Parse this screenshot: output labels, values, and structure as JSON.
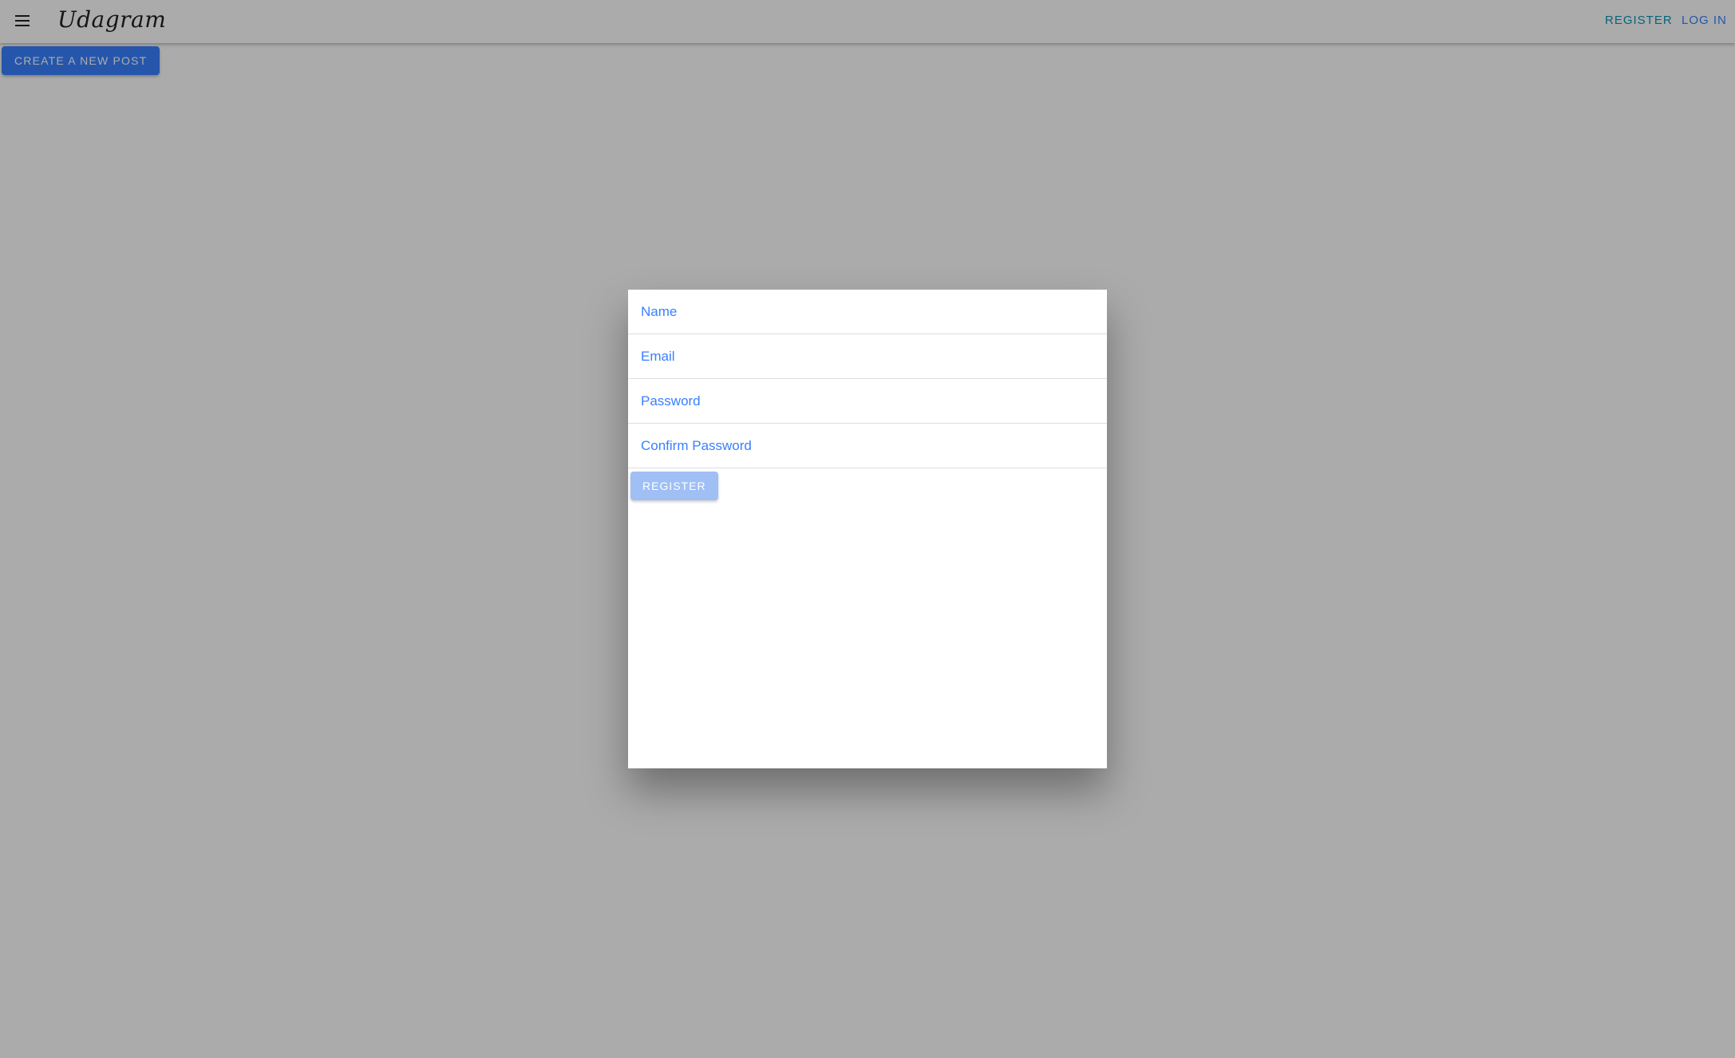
{
  "toolbar": {
    "menu_icon": "menu-icon",
    "brand": "Udagram",
    "register_label": "REGISTER",
    "login_label": "LOG IN"
  },
  "main": {
    "create_post_label": "CREATE A NEW POST"
  },
  "modal": {
    "fields": [
      {
        "label": "Name",
        "value": ""
      },
      {
        "label": "Email",
        "value": ""
      },
      {
        "label": "Password",
        "value": ""
      },
      {
        "label": "Confirm Password",
        "value": ""
      }
    ],
    "submit_label": "REGISTER"
  },
  "colors": {
    "primary": "#3880ff",
    "secondary": "#0b96b6",
    "disabled_button": "#9fbff5",
    "backdrop": "rgba(0,0,0,0.33)"
  }
}
